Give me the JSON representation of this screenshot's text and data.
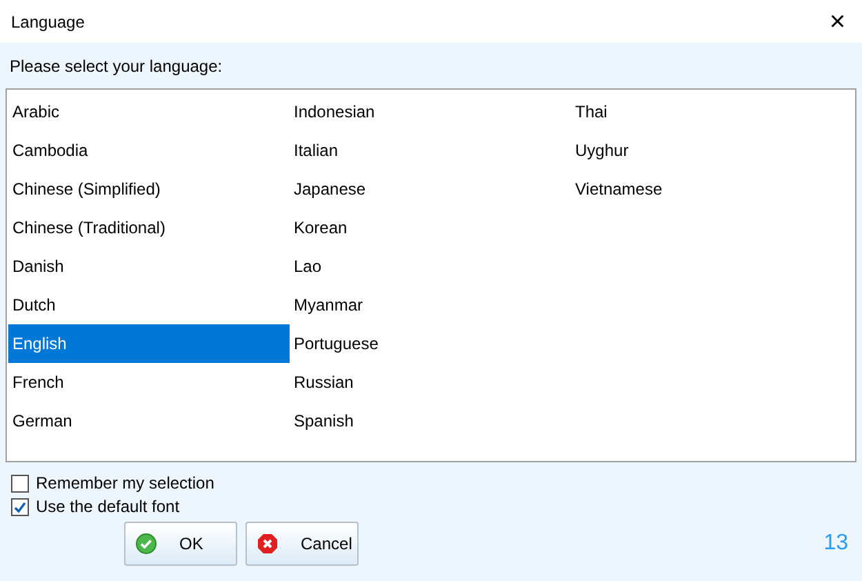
{
  "window": {
    "title": "Language",
    "close": "×"
  },
  "prompt": "Please select your language:",
  "languages": [
    {
      "label": "Arabic",
      "selected": false
    },
    {
      "label": "Cambodia",
      "selected": false
    },
    {
      "label": "Chinese (Simplified)",
      "selected": false
    },
    {
      "label": "Chinese (Traditional)",
      "selected": false
    },
    {
      "label": "Danish",
      "selected": false
    },
    {
      "label": "Dutch",
      "selected": false
    },
    {
      "label": "English",
      "selected": true
    },
    {
      "label": "French",
      "selected": false
    },
    {
      "label": "German",
      "selected": false
    },
    {
      "label": "Indonesian",
      "selected": false
    },
    {
      "label": "Italian",
      "selected": false
    },
    {
      "label": "Japanese",
      "selected": false
    },
    {
      "label": "Korean",
      "selected": false
    },
    {
      "label": "Lao",
      "selected": false
    },
    {
      "label": "Myanmar",
      "selected": false
    },
    {
      "label": "Portuguese",
      "selected": false
    },
    {
      "label": "Russian",
      "selected": false
    },
    {
      "label": "Spanish",
      "selected": false
    },
    {
      "label": "Thai",
      "selected": false
    },
    {
      "label": "Uyghur",
      "selected": false
    },
    {
      "label": "Vietnamese",
      "selected": false
    }
  ],
  "options": [
    {
      "label": "Remember my selection",
      "checked": false
    },
    {
      "label": "Use the default font",
      "checked": true
    }
  ],
  "buttons": [
    {
      "label": "OK",
      "kind": "ok"
    },
    {
      "label": "Cancel",
      "kind": "cancel"
    }
  ],
  "count": "13"
}
